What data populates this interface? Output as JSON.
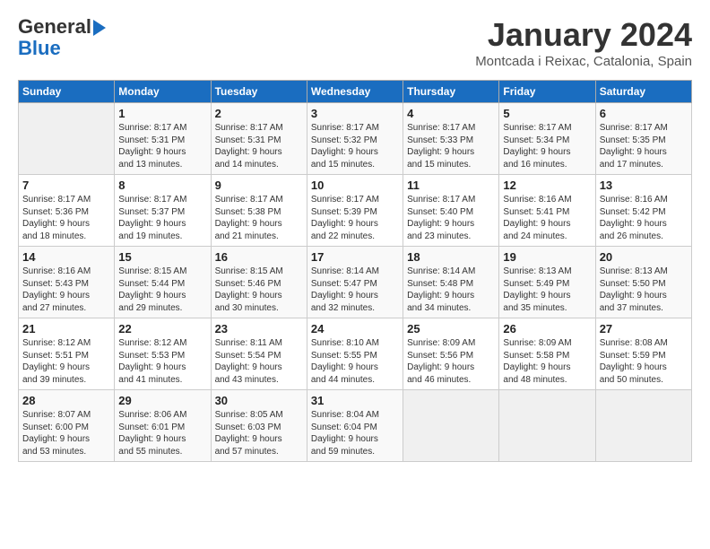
{
  "header": {
    "logo_line1": "General",
    "logo_line2": "Blue",
    "month_title": "January 2024",
    "location": "Montcada i Reixac, Catalonia, Spain"
  },
  "weekdays": [
    "Sunday",
    "Monday",
    "Tuesday",
    "Wednesday",
    "Thursday",
    "Friday",
    "Saturday"
  ],
  "weeks": [
    [
      {
        "day": "",
        "info": ""
      },
      {
        "day": "1",
        "info": "Sunrise: 8:17 AM\nSunset: 5:31 PM\nDaylight: 9 hours\nand 13 minutes."
      },
      {
        "day": "2",
        "info": "Sunrise: 8:17 AM\nSunset: 5:31 PM\nDaylight: 9 hours\nand 14 minutes."
      },
      {
        "day": "3",
        "info": "Sunrise: 8:17 AM\nSunset: 5:32 PM\nDaylight: 9 hours\nand 15 minutes."
      },
      {
        "day": "4",
        "info": "Sunrise: 8:17 AM\nSunset: 5:33 PM\nDaylight: 9 hours\nand 15 minutes."
      },
      {
        "day": "5",
        "info": "Sunrise: 8:17 AM\nSunset: 5:34 PM\nDaylight: 9 hours\nand 16 minutes."
      },
      {
        "day": "6",
        "info": "Sunrise: 8:17 AM\nSunset: 5:35 PM\nDaylight: 9 hours\nand 17 minutes."
      }
    ],
    [
      {
        "day": "7",
        "info": "Sunrise: 8:17 AM\nSunset: 5:36 PM\nDaylight: 9 hours\nand 18 minutes."
      },
      {
        "day": "8",
        "info": "Sunrise: 8:17 AM\nSunset: 5:37 PM\nDaylight: 9 hours\nand 19 minutes."
      },
      {
        "day": "9",
        "info": "Sunrise: 8:17 AM\nSunset: 5:38 PM\nDaylight: 9 hours\nand 21 minutes."
      },
      {
        "day": "10",
        "info": "Sunrise: 8:17 AM\nSunset: 5:39 PM\nDaylight: 9 hours\nand 22 minutes."
      },
      {
        "day": "11",
        "info": "Sunrise: 8:17 AM\nSunset: 5:40 PM\nDaylight: 9 hours\nand 23 minutes."
      },
      {
        "day": "12",
        "info": "Sunrise: 8:16 AM\nSunset: 5:41 PM\nDaylight: 9 hours\nand 24 minutes."
      },
      {
        "day": "13",
        "info": "Sunrise: 8:16 AM\nSunset: 5:42 PM\nDaylight: 9 hours\nand 26 minutes."
      }
    ],
    [
      {
        "day": "14",
        "info": "Sunrise: 8:16 AM\nSunset: 5:43 PM\nDaylight: 9 hours\nand 27 minutes."
      },
      {
        "day": "15",
        "info": "Sunrise: 8:15 AM\nSunset: 5:44 PM\nDaylight: 9 hours\nand 29 minutes."
      },
      {
        "day": "16",
        "info": "Sunrise: 8:15 AM\nSunset: 5:46 PM\nDaylight: 9 hours\nand 30 minutes."
      },
      {
        "day": "17",
        "info": "Sunrise: 8:14 AM\nSunset: 5:47 PM\nDaylight: 9 hours\nand 32 minutes."
      },
      {
        "day": "18",
        "info": "Sunrise: 8:14 AM\nSunset: 5:48 PM\nDaylight: 9 hours\nand 34 minutes."
      },
      {
        "day": "19",
        "info": "Sunrise: 8:13 AM\nSunset: 5:49 PM\nDaylight: 9 hours\nand 35 minutes."
      },
      {
        "day": "20",
        "info": "Sunrise: 8:13 AM\nSunset: 5:50 PM\nDaylight: 9 hours\nand 37 minutes."
      }
    ],
    [
      {
        "day": "21",
        "info": "Sunrise: 8:12 AM\nSunset: 5:51 PM\nDaylight: 9 hours\nand 39 minutes."
      },
      {
        "day": "22",
        "info": "Sunrise: 8:12 AM\nSunset: 5:53 PM\nDaylight: 9 hours\nand 41 minutes."
      },
      {
        "day": "23",
        "info": "Sunrise: 8:11 AM\nSunset: 5:54 PM\nDaylight: 9 hours\nand 43 minutes."
      },
      {
        "day": "24",
        "info": "Sunrise: 8:10 AM\nSunset: 5:55 PM\nDaylight: 9 hours\nand 44 minutes."
      },
      {
        "day": "25",
        "info": "Sunrise: 8:09 AM\nSunset: 5:56 PM\nDaylight: 9 hours\nand 46 minutes."
      },
      {
        "day": "26",
        "info": "Sunrise: 8:09 AM\nSunset: 5:58 PM\nDaylight: 9 hours\nand 48 minutes."
      },
      {
        "day": "27",
        "info": "Sunrise: 8:08 AM\nSunset: 5:59 PM\nDaylight: 9 hours\nand 50 minutes."
      }
    ],
    [
      {
        "day": "28",
        "info": "Sunrise: 8:07 AM\nSunset: 6:00 PM\nDaylight: 9 hours\nand 53 minutes."
      },
      {
        "day": "29",
        "info": "Sunrise: 8:06 AM\nSunset: 6:01 PM\nDaylight: 9 hours\nand 55 minutes."
      },
      {
        "day": "30",
        "info": "Sunrise: 8:05 AM\nSunset: 6:03 PM\nDaylight: 9 hours\nand 57 minutes."
      },
      {
        "day": "31",
        "info": "Sunrise: 8:04 AM\nSunset: 6:04 PM\nDaylight: 9 hours\nand 59 minutes."
      },
      {
        "day": "",
        "info": ""
      },
      {
        "day": "",
        "info": ""
      },
      {
        "day": "",
        "info": ""
      }
    ]
  ]
}
